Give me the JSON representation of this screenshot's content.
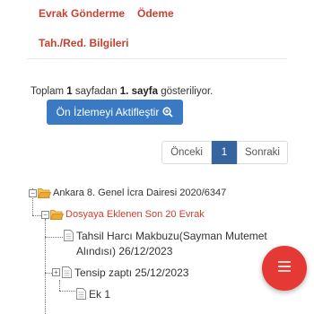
{
  "tabs": {
    "evrak": "Evrak Gönderme",
    "odeme": "Ödeme",
    "tah": "Tah./Red. Bilgileri"
  },
  "summary": {
    "prefix": "Toplam",
    "total": "1",
    "middle": "sayfadan",
    "page": "1. sayfa",
    "suffix": "gösteriliyor."
  },
  "preview_button": {
    "label": "Ön İzlemeyi Aktifleştir",
    "icon": "zoom-in-icon"
  },
  "pagination": {
    "prev": "Önceki",
    "current": "1",
    "next": "Sonraki"
  },
  "tree": {
    "root": {
      "label": "Ankara 8. Genel İcra Dairesi 2020/6347",
      "toggle": "−"
    },
    "folder": {
      "label": "Dosyaya Eklenen Son 20 Evrak",
      "toggle": "−"
    },
    "doc1": {
      "line1": "Tahsil Harcı Makbuzu(Sayman Mutemet",
      "line2": "Alındısı) 26/12/2023"
    },
    "doc2": {
      "label": "Tensip zaptı 25/12/2023",
      "toggle": "+"
    },
    "doc3": {
      "label": "Ek 1"
    }
  },
  "fab": {
    "icon": "menu-icon"
  },
  "colors": {
    "tab_text": "#c8402f",
    "folder_text": "#c8402f",
    "primary": "#3a79c4",
    "page_active": "#35649e",
    "fab": "#e53935",
    "folder_icon": "#f0a830"
  }
}
